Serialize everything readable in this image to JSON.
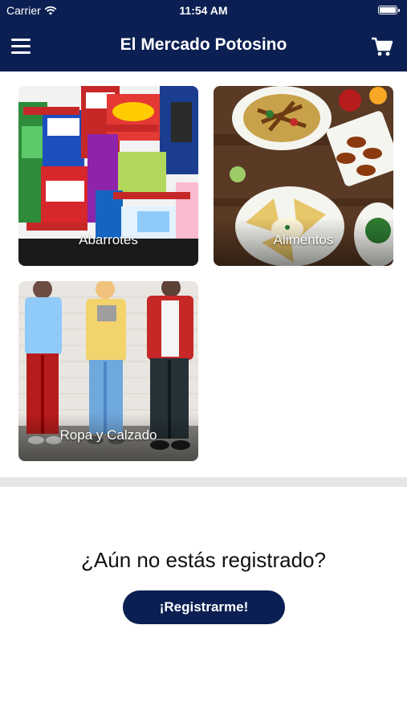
{
  "status_bar": {
    "carrier": "Carrier",
    "time": "11:54 AM",
    "icons": [
      "wifi-icon",
      "battery-icon"
    ]
  },
  "nav": {
    "title": "El Mercado Potosino",
    "menu_icon": "hamburger-menu-icon",
    "cart_icon": "shopping-cart-icon"
  },
  "categories": [
    {
      "label": "Abarrotes"
    },
    {
      "label": "Alimentos"
    },
    {
      "label": "Ropa y Calzado"
    }
  ],
  "register": {
    "question": "¿Aún no estás registrado?",
    "button_label": "¡Registrarme!"
  },
  "colors": {
    "brand_navy": "#0b1f52",
    "divider_gray": "#e6e6e6"
  }
}
